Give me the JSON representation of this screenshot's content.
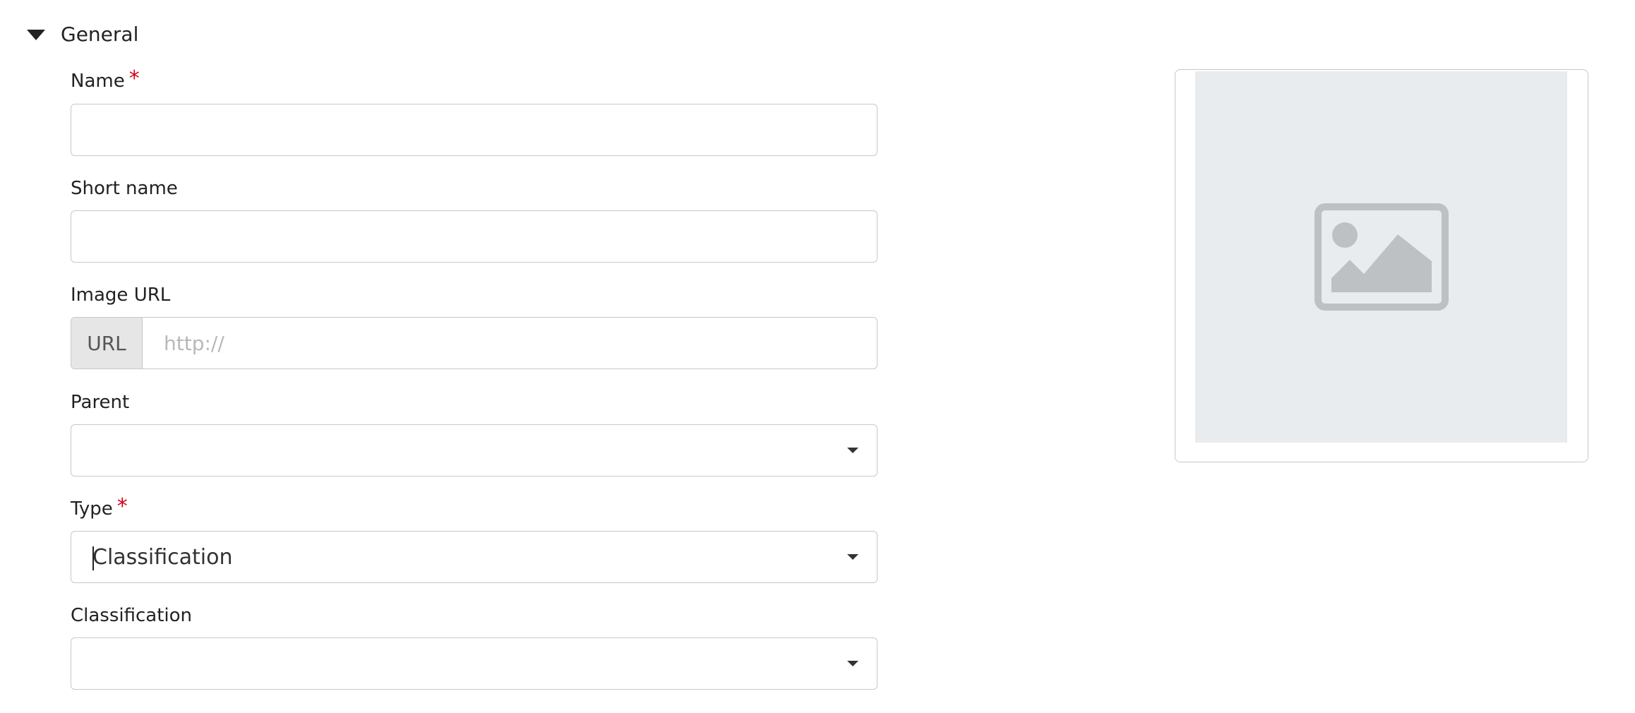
{
  "section": {
    "title": "General",
    "caret_icon": "caret-down-icon"
  },
  "fields": {
    "name": {
      "label": "Name",
      "required_mark": "*",
      "value": ""
    },
    "short_name": {
      "label": "Short name",
      "value": ""
    },
    "image_url": {
      "label": "Image URL",
      "addon": "URL",
      "placeholder": "http://"
    },
    "parent": {
      "label": "Parent",
      "value": ""
    },
    "type": {
      "label": "Type",
      "required_mark": "*",
      "value": "Classification"
    },
    "classification": {
      "label": "Classification",
      "value": ""
    }
  },
  "preview": {
    "icon": "image-placeholder-icon"
  },
  "colors": {
    "required": "#d0021b",
    "border": "#c8c8c8",
    "placeholder_bg": "#e8ecee",
    "placeholder_icon": "#bdc1c4"
  }
}
